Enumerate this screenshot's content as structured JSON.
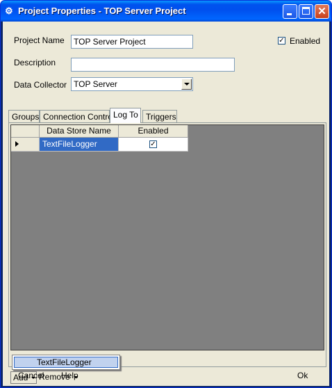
{
  "window": {
    "title": "Project Properties - TOP Server Project",
    "icon": "app-icon",
    "controls": {
      "minimize": "minimize-icon",
      "maximize": "maximize-icon",
      "close": "close-icon"
    }
  },
  "form": {
    "project_name_label": "Project Name",
    "project_name_value": "TOP Server Project",
    "enabled_label": "Enabled",
    "enabled_checked": true,
    "description_label": "Description",
    "description_value": "",
    "data_collector_label": "Data Collector",
    "data_collector_value": "TOP Server"
  },
  "tabs": [
    {
      "label": "Groups",
      "active": false
    },
    {
      "label": "Connection Control",
      "active": false
    },
    {
      "label": "Log To",
      "active": true
    },
    {
      "label": "Triggers",
      "active": false
    }
  ],
  "grid": {
    "columns": [
      "Data Store Name",
      "Enabled"
    ],
    "rows": [
      {
        "name": "TextFileLogger",
        "enabled": true,
        "selected": true
      }
    ]
  },
  "popup": {
    "items": [
      "TextFileLogger"
    ]
  },
  "strip": {
    "add_label": "Add",
    "remove_label": "Remove"
  },
  "footer": {
    "cancel_label": "Cancel",
    "help_label": "Help",
    "ok_label": "Ok"
  },
  "colors": {
    "titlebar": "#0053ee",
    "selection": "#316ac5",
    "grid_background": "#808080",
    "dialog": "#ece9d8"
  }
}
